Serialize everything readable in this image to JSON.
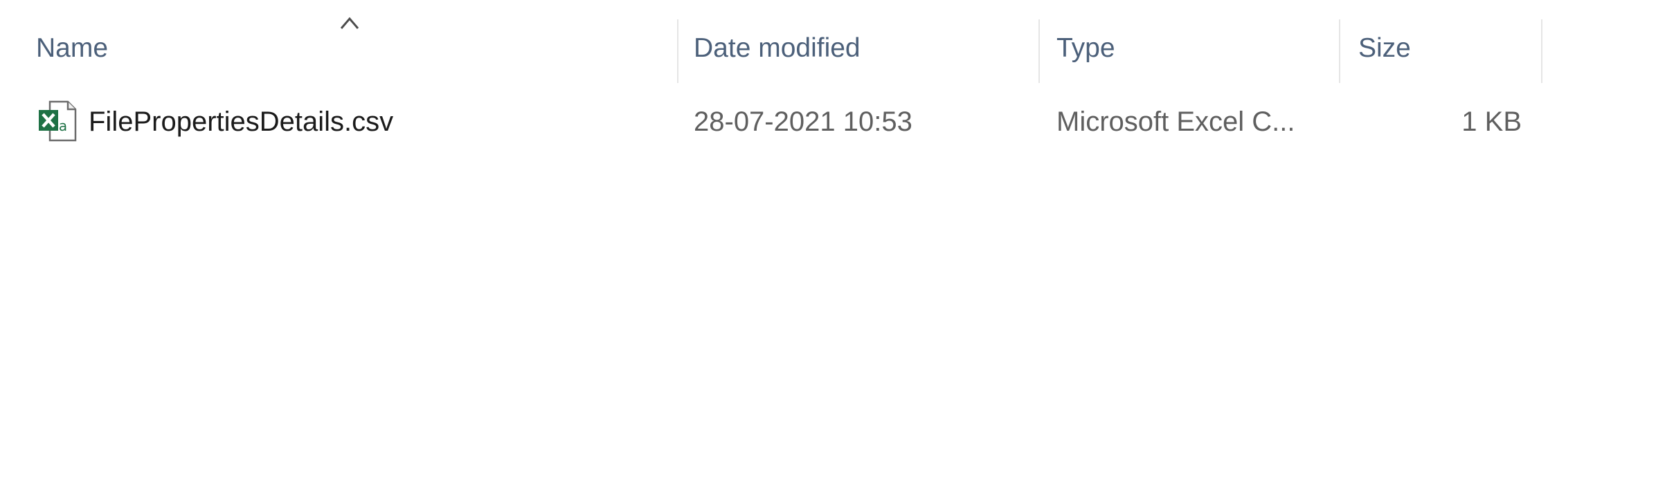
{
  "columns": {
    "name": "Name",
    "date_modified": "Date modified",
    "type": "Type",
    "size": "Size"
  },
  "sort": {
    "column": "name",
    "direction": "ascending",
    "icon": "chevron-up-icon"
  },
  "files": [
    {
      "icon": "excel-csv-icon",
      "name": "FilePropertiesDetails.csv",
      "date_modified": "28-07-2021 10:53",
      "type": "Microsoft Excel C...",
      "size": "1 KB"
    }
  ],
  "colors": {
    "header_text": "#4c607a",
    "excel_green": "#1e7145",
    "divider": "#e5e5e5"
  }
}
